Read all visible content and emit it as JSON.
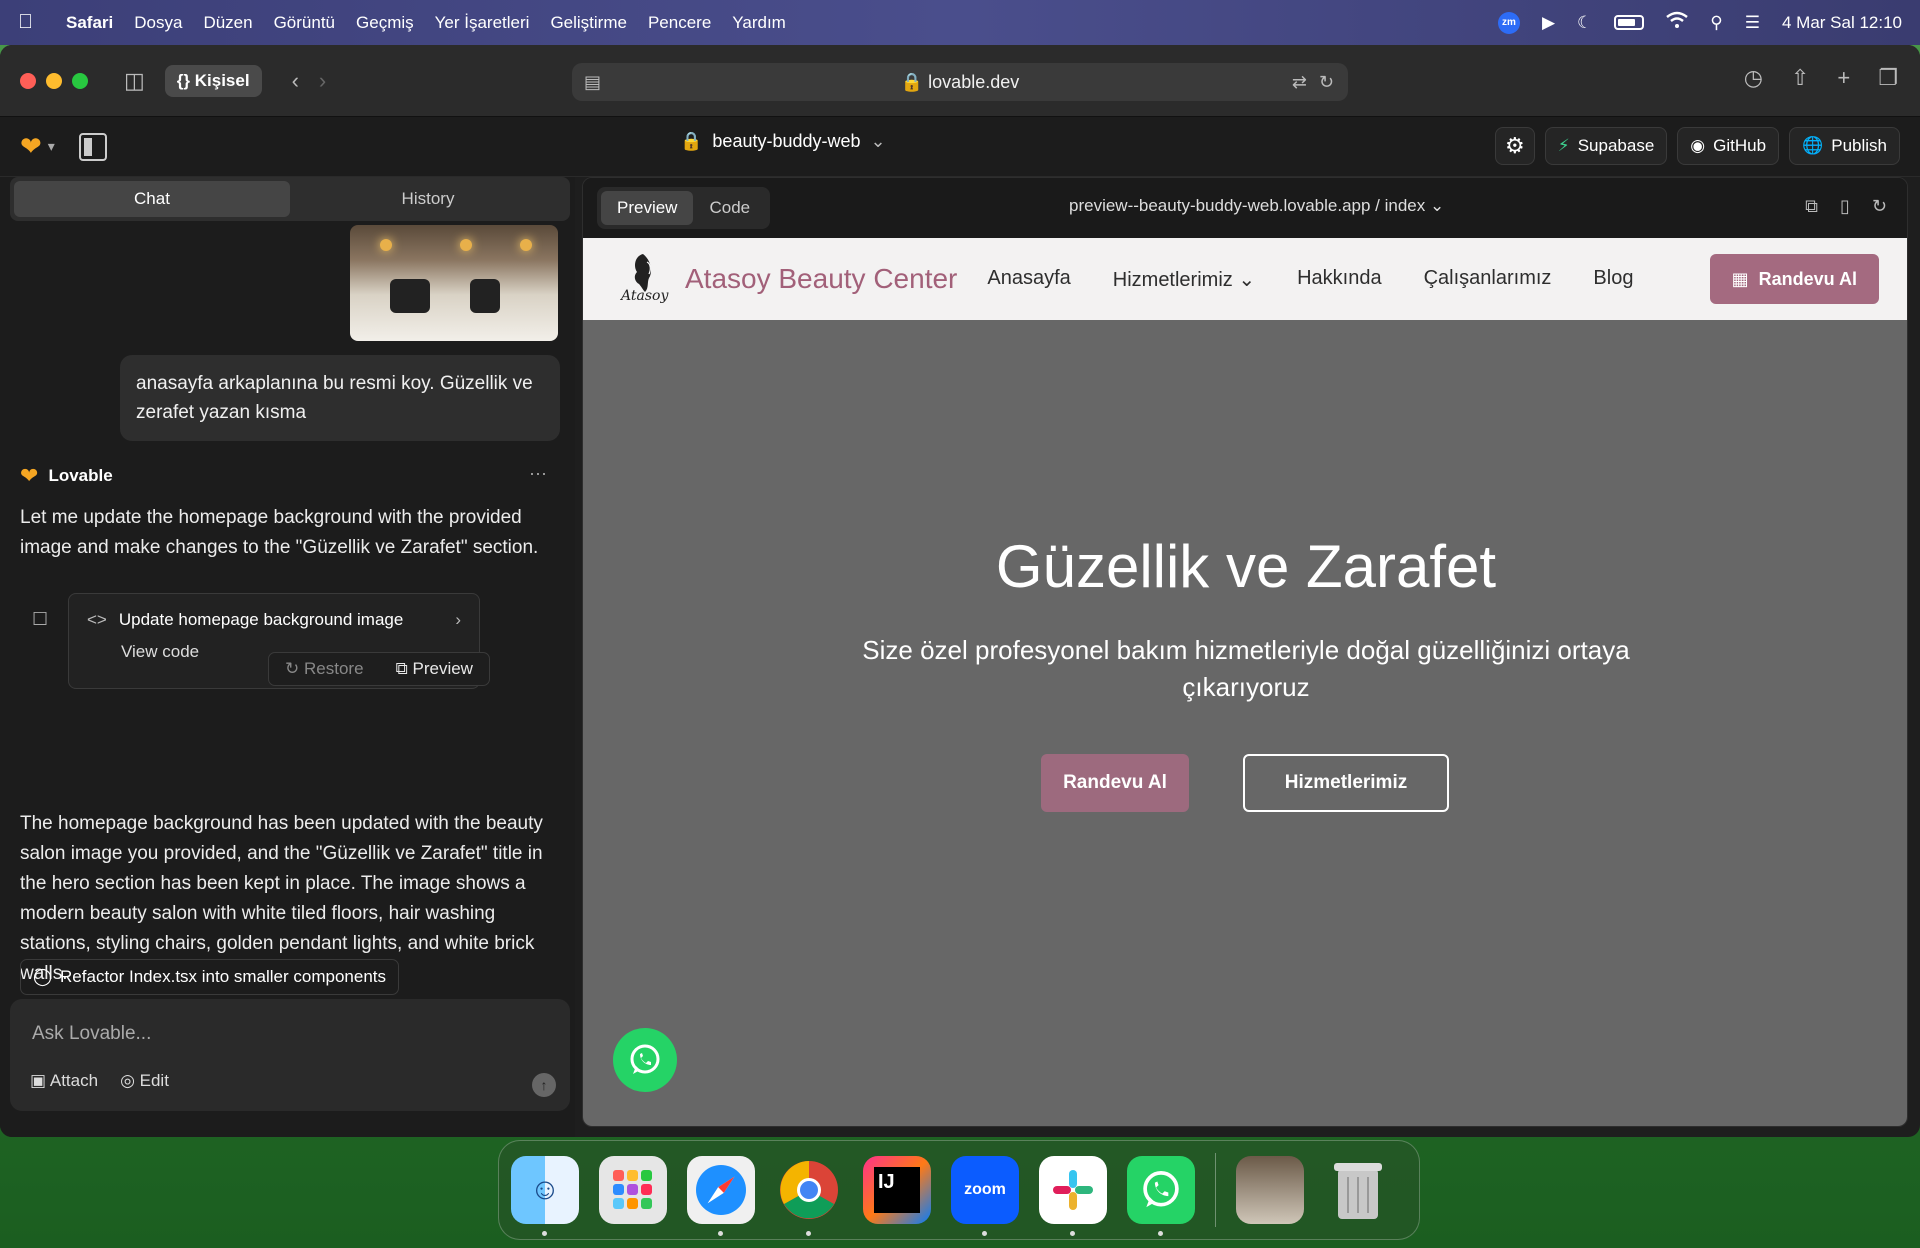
{
  "menubar": {
    "app": "Safari",
    "items": [
      "Dosya",
      "Düzen",
      "Görüntü",
      "Geçmiş",
      "Yer İşaretleri",
      "Geliştirme",
      "Pencere",
      "Yardım"
    ],
    "zoom_badge": "zm",
    "datetime": "4 Mar Sal  12:10"
  },
  "browser": {
    "profile": "{} Kişisel",
    "url": "lovable.dev"
  },
  "appbar": {
    "project": "beauty-buddy-web",
    "supabase": "Supabase",
    "github": "GitHub",
    "publish": "Publish"
  },
  "chat": {
    "tab_chat": "Chat",
    "tab_history": "History",
    "user_message": "anasayfa arkaplanına bu resmi koy. Güzellik ve zerafet yazan kısma",
    "assistant_name": "Lovable",
    "assistant_intro": "Let me update the homepage background with the provided image and make changes to the \"Güzellik ve Zarafet\" section.",
    "edit_card_title": "Update homepage background image",
    "edit_card_view": "View code",
    "restore": "Restore",
    "preview": "Preview",
    "assistant_result": "The homepage background has been updated with the beauty salon image you provided, and the \"Güzellik ve Zarafet\" title in the hero section has been kept in place. The image shows a modern beauty salon with white tiled floors, hair washing stations, styling chairs, golden pendant lights, and white brick walls.",
    "suggestion": "Refactor Index.tsx into smaller components",
    "input_placeholder": "Ask Lovable...",
    "attach": "Attach",
    "edit": "Edit"
  },
  "preview_panel": {
    "tab_preview": "Preview",
    "tab_code": "Code",
    "url": "preview--beauty-buddy-web.lovable.app / index"
  },
  "site": {
    "brand": "Atasoy Beauty Center",
    "logo_text": "Atasoy",
    "nav": {
      "home": "Anasayfa",
      "services": "Hizmetlerimiz",
      "about": "Hakkında",
      "staff": "Çalışanlarımız",
      "blog": "Blog"
    },
    "nav_cta": "Randevu Al",
    "hero_title": "Güzellik ve Zarafet",
    "hero_subtitle": "Size özel profesyonel bakım hizmetleriyle doğal güzelliğinizi ortaya çıkarıyoruz",
    "btn_appointment": "Randevu Al",
    "btn_services": "Hizmetlerimiz",
    "zoom_logo": "zoom"
  },
  "colors": {
    "brand": "#a26079",
    "cta": "#a46a80",
    "whatsapp": "#25d366"
  }
}
